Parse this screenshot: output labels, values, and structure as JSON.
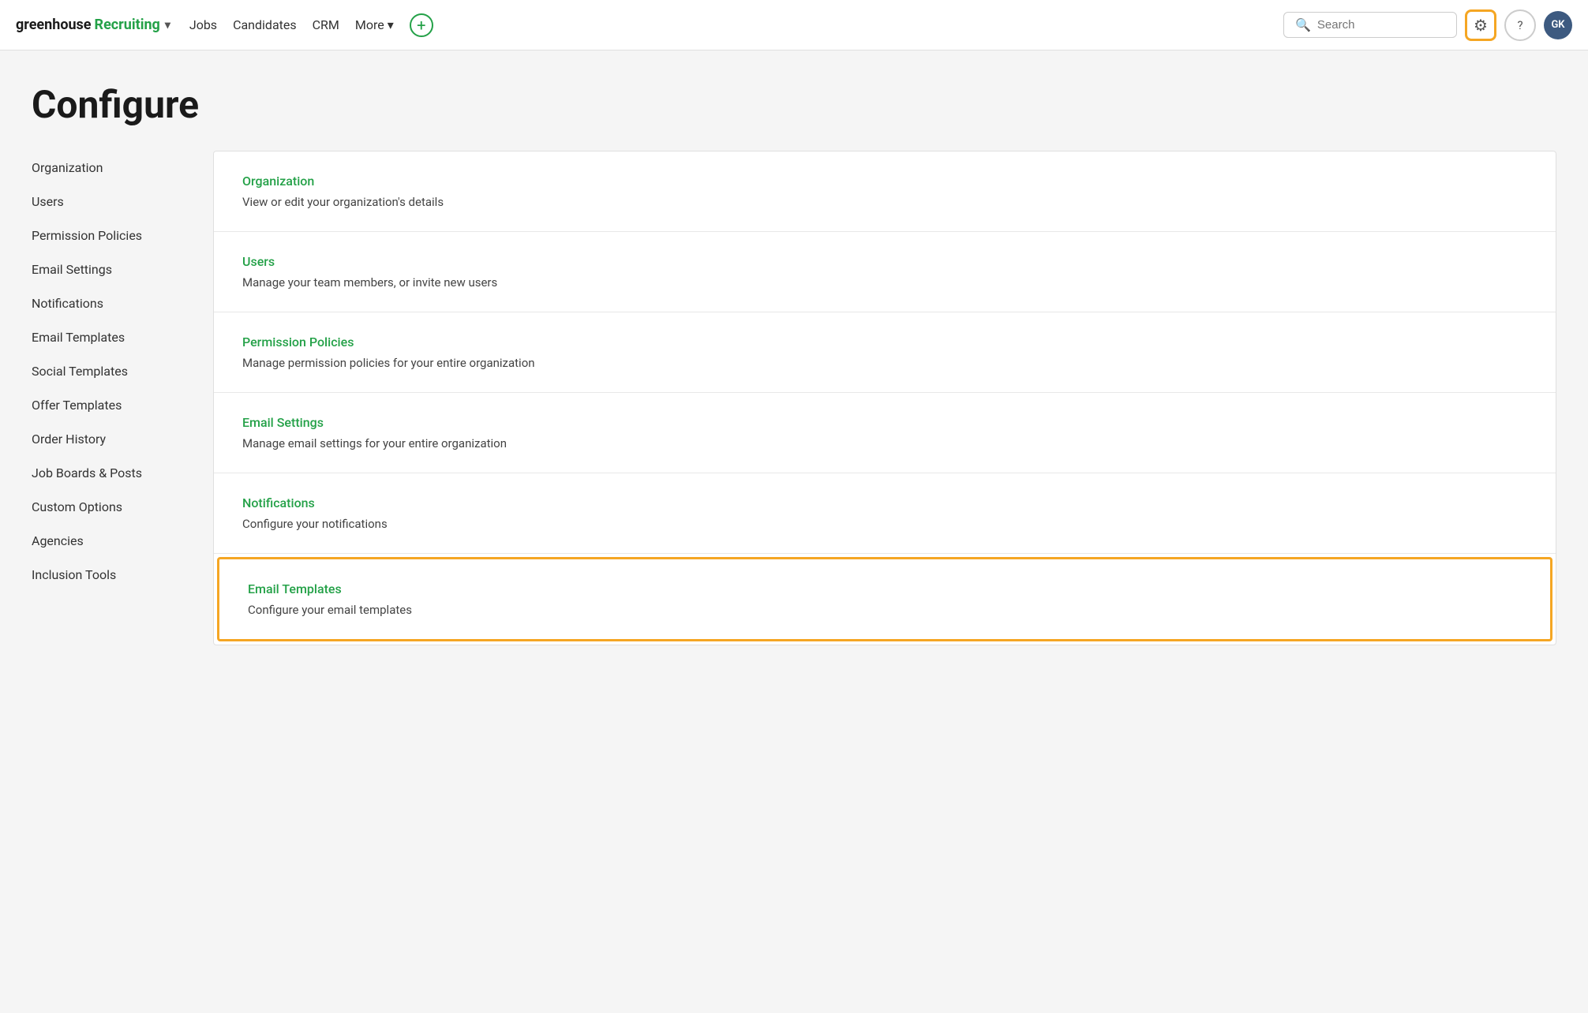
{
  "brand": {
    "greenhouse": "greenhouse",
    "recruiting": "Recruiting",
    "chevron": "▾"
  },
  "nav": {
    "links": [
      {
        "label": "Jobs",
        "chevron": ""
      },
      {
        "label": "Candidates",
        "chevron": ""
      },
      {
        "label": "CRM",
        "chevron": ""
      },
      {
        "label": "More",
        "chevron": "▾"
      }
    ],
    "add_icon": "+",
    "search_placeholder": "Search",
    "gear_icon": "⚙",
    "help_icon": "?",
    "avatar_text": "GK"
  },
  "page": {
    "title": "Configure"
  },
  "sidebar": {
    "items": [
      {
        "label": "Organization"
      },
      {
        "label": "Users"
      },
      {
        "label": "Permission Policies"
      },
      {
        "label": "Email Settings"
      },
      {
        "label": "Notifications"
      },
      {
        "label": "Email Templates"
      },
      {
        "label": "Social Templates"
      },
      {
        "label": "Offer Templates"
      },
      {
        "label": "Order History"
      },
      {
        "label": "Job Boards & Posts"
      },
      {
        "label": "Custom Options"
      },
      {
        "label": "Agencies"
      },
      {
        "label": "Inclusion Tools"
      }
    ]
  },
  "content": {
    "items": [
      {
        "title": "Organization",
        "description": "View or edit your organization's details",
        "highlighted": false
      },
      {
        "title": "Users",
        "description": "Manage your team members, or invite new users",
        "highlighted": false
      },
      {
        "title": "Permission Policies",
        "description": "Manage permission policies for your entire organization",
        "highlighted": false
      },
      {
        "title": "Email Settings",
        "description": "Manage email settings for your entire organization",
        "highlighted": false
      },
      {
        "title": "Notifications",
        "description": "Configure your notifications",
        "highlighted": false
      },
      {
        "title": "Email Templates",
        "description": "Configure your email templates",
        "highlighted": true
      }
    ]
  }
}
